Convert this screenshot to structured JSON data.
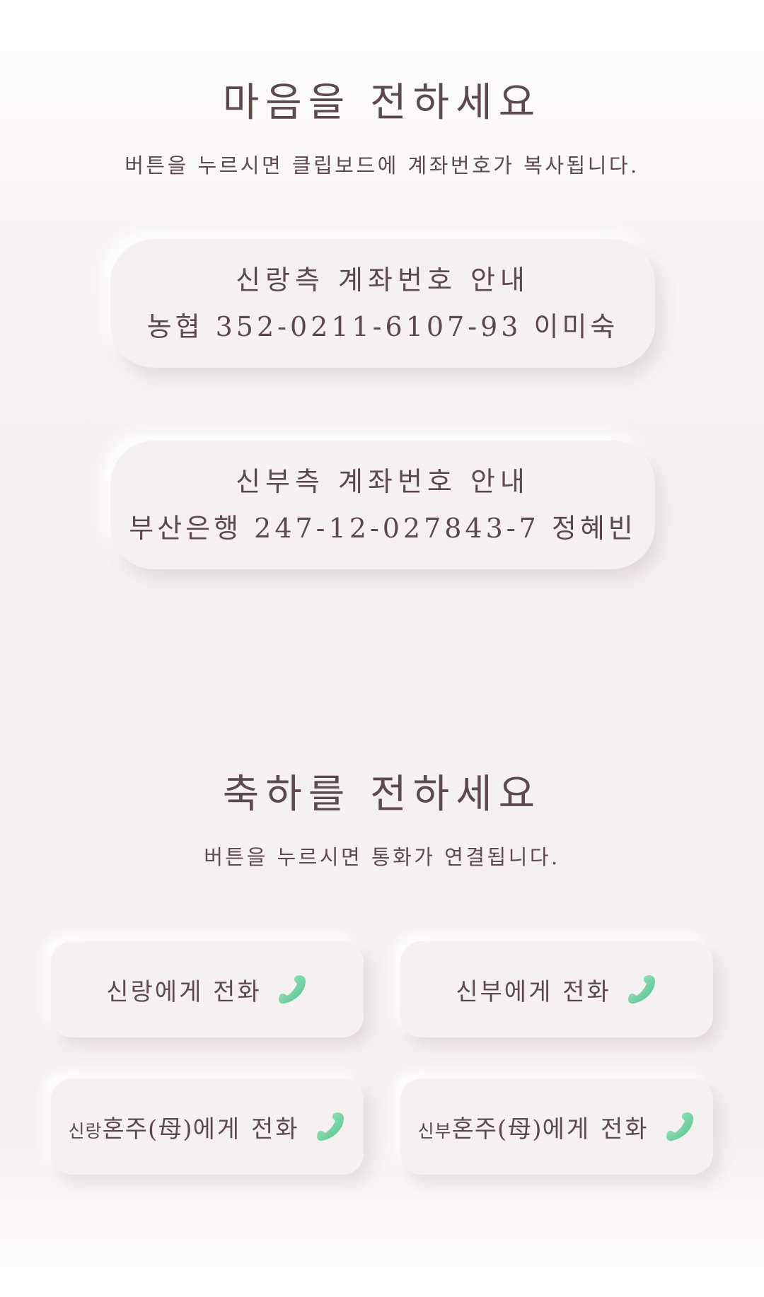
{
  "gift_section": {
    "title": "마음을 전하세요",
    "subtitle": "버튼을 누르시면 클립보드에 계좌번호가 복사됩니다.",
    "accounts": [
      {
        "heading": "신랑측 계좌번호 안내",
        "detail": "농협 352-0211-6107-93 이미숙"
      },
      {
        "heading": "신부측 계좌번호 안내",
        "detail": "부산은행 247-12-027843-7 정혜빈"
      }
    ]
  },
  "call_section": {
    "title": "축하를 전하세요",
    "subtitle": "버튼을 누르시면 통화가 연결됩니다.",
    "buttons": [
      {
        "label": "신랑에게 전화",
        "icon": "phone-icon"
      },
      {
        "label": "신부에게 전화",
        "icon": "phone-icon"
      },
      {
        "prefix": "신랑",
        "middle": "혼주(母)",
        "suffix": "에게 전화",
        "icon": "phone-icon"
      },
      {
        "prefix": "신부",
        "middle": "혼주(母)",
        "suffix": "에게 전화",
        "icon": "phone-icon"
      }
    ]
  },
  "colors": {
    "text": "#5d4b4b",
    "card_background": "#f6f1f1",
    "phone_icon": "#6fcfa0"
  }
}
